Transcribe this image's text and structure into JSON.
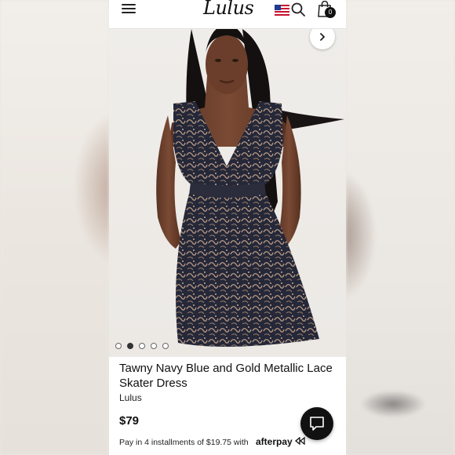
{
  "header": {
    "logo_text": "Lulus",
    "cart_count": "0",
    "icons": [
      "menu-icon",
      "us-flag-icon",
      "search-icon",
      "shopping-bag-icon"
    ]
  },
  "gallery": {
    "slide_count": 5,
    "active_slide": 2,
    "next_icon": "chevron-right-icon"
  },
  "product": {
    "title": "Tawny Navy Blue and Gold Metallic Lace Skater Dress",
    "brand": "Lulus",
    "price": "$79",
    "installments_text": "Pay in 4 installments of $19.75 with",
    "afterpay_label": "afterpay"
  },
  "chat": {
    "icon": "chat-bubble-icon"
  },
  "colors": {
    "accent": "#111111",
    "dress_navy": "#252838",
    "dress_gold": "#b89a86"
  }
}
